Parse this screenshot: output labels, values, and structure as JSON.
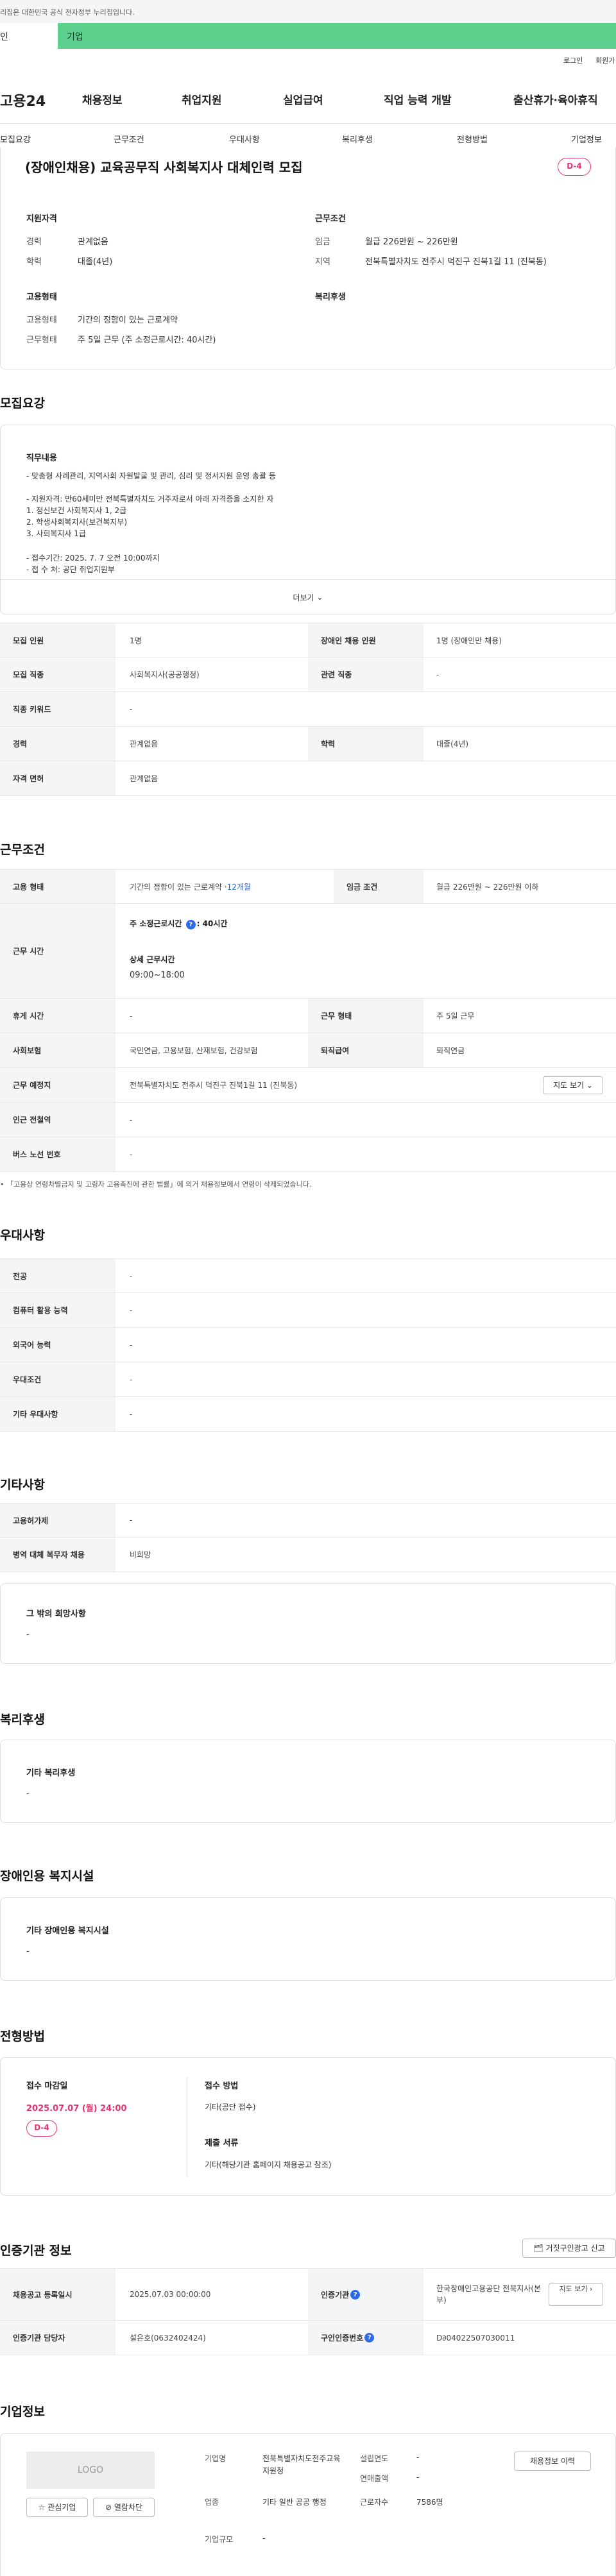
{
  "gov_notice": "리집은 대한민국 공식 전자정부 누리집입니다.",
  "top_tabs": [
    "인",
    "기업"
  ],
  "util": {
    "login": "로그인",
    "join": "회원가"
  },
  "gnb": {
    "logo": "고용24",
    "items": [
      "채용정보",
      "취업지원",
      "실업급여",
      "직업 능력 개발",
      "출산휴가·육아휴직"
    ]
  },
  "subnav": [
    "모집요강",
    "근무조건",
    "우대사항",
    "복리후생",
    "전형방법",
    "기업정보"
  ],
  "job": {
    "title": "(장애인채용) 교육공무직 사회복지사 대체인력 모집",
    "dday": "D-4"
  },
  "summary": {
    "qual_title": "지원자격",
    "career_label": "경력",
    "career": "관계없음",
    "edu_label": "학력",
    "edu": "대졸(4년)",
    "cond_title": "근무조건",
    "wage_label": "임금",
    "wage": "월급 226만원 ~ 226만원",
    "region_label": "지역",
    "region": "전북특별자치도 전주시 덕진구 진북1길 11 (진북동)",
    "emp_title": "고용형태",
    "emp_label": "고용형태",
    "emp": "기간의 정함이 있는 근로계약",
    "work_label": "근무형태",
    "work": "주 5일 근무 (주 소정근로시간: 40시간)",
    "welfare_title": "복리후생"
  },
  "recruit": {
    "section": "모집요강",
    "duty_title": "직무내용",
    "lines": [
      "- 맞춤형 사례관리, 지역사회 자원발굴 및 관리, 심리 및 정서지원 운영 총괄 등",
      "- 지원자격: 만60세미만 전북특별자치도 거주자로서 아래 자격증을 소지한 자",
      "1. 정신보건 사회복지사 1, 2급",
      "2. 학생사회복지사(보건복지부)",
      "3. 사회복지사 1급",
      "- 접수기간: 2025. 7. 7 오전 10:00까지",
      "- 접 수 처: 공단 취업지원부"
    ],
    "more": "더보기",
    "rows": [
      [
        "모집 인원",
        "1명",
        "장애인 채용 인원",
        "1명 (장애인만 채용)"
      ],
      [
        "모집 직종",
        "사회복지사(공공행정)",
        "관련 직종",
        "-"
      ],
      [
        "직종 키워드",
        "-"
      ],
      [
        "경력",
        "관계없음",
        "학력",
        "대졸(4년)"
      ],
      [
        "자격 면허",
        "관계없음"
      ]
    ]
  },
  "conditions": {
    "section": "근무조건",
    "emp_type_label": "고용 형태",
    "emp_type": "기간의 정함이 있는 근로계약 · ",
    "emp_months": "12개월",
    "wage_label": "임금 조건",
    "wage": "월급 226만원 ~ 226만원 이하",
    "time_label": "근무 시간",
    "weekly_label": "주 소정근로시간",
    "weekly": ": 40시간",
    "detail_label": "상세 근무시간",
    "detail": "09:00~18:00",
    "rest_label": "휴게 시간",
    "rest": "-",
    "form_label": "근무 형태",
    "form": "주 5일 근무",
    "ins_label": "사회보험",
    "ins": "국민연금, 고용보험, 산재보험, 건강보험",
    "sev_label": "퇴직급여",
    "sev": "퇴직연금",
    "place_label": "근무 예정지",
    "place": "전북특별자치도 전주시 덕진구 진북1길 11 (진북동)",
    "map_btn": "지도 보기",
    "station_label": "인근 전철역",
    "station": "-",
    "bus_label": "버스 노선 번호",
    "bus": "-",
    "note": "「고용상 연령차별금지 및 고령자 고용촉진에 관한 법률」에 의거 채용정보에서 연령이 삭제되었습니다."
  },
  "pref": {
    "section": "우대사항",
    "rows": [
      [
        "전공",
        "-"
      ],
      [
        "컴퓨터 활용 능력",
        "-"
      ],
      [
        "외국어 능력",
        "-"
      ],
      [
        "우대조건",
        "-"
      ],
      [
        "기타 우대사항",
        "-"
      ]
    ]
  },
  "etc": {
    "section": "기타사항",
    "rows": [
      [
        "고용허가제",
        "-"
      ],
      [
        "병역 대체 복무자 채용",
        "비희망"
      ]
    ],
    "hope_title": "그 밖의 희망사항",
    "hope": "-"
  },
  "welfare": {
    "section": "복리후생",
    "title": "기타 복리후생",
    "value": "-"
  },
  "facility": {
    "section": "장애인용 복지시설",
    "title": "기타 장애인용 복지시설",
    "value": "-"
  },
  "process": {
    "section": "전형방법",
    "deadline_label": "접수 마감일",
    "deadline": "2025.07.07 (월) 24:00",
    "dday": "D-4",
    "method_label": "접수 방법",
    "method": "기타(공단 접수)",
    "docs_label": "제출 서류",
    "docs": "기타(해당기관 홈페이지 채용공고 참조)"
  },
  "cert": {
    "section": "인증기관 정보",
    "report_btn": "거짓구인광고 신고",
    "reg_label": "채용공고 등록일시",
    "reg": "2025.07.03 00:00:00",
    "org_label": "인증기관",
    "org": "한국장애인고용공단 전북지사(본부)",
    "map_btn": "지도 보기",
    "mgr_label": "인증기관 담당자",
    "mgr": "설은호(0632402424)",
    "num_label": "구인인증번호",
    "num": "D∂04022507030011"
  },
  "company": {
    "section": "기업정보",
    "logo": "LOGO",
    "fav_btn": "관심기업",
    "block_btn": "열람차단",
    "name_label": "기업명",
    "name": "전북특별자치도전주교육지원청",
    "year_label": "설립연도",
    "year": "-",
    "sales_label": "연매출액",
    "sales": "-",
    "industry_label": "업종",
    "industry": "기타 일반 공공 행정",
    "emp_label": "근로자수",
    "emp": "7586명",
    "size_label": "기업규모",
    "size": "-",
    "more_btn": "채용정보 이력"
  }
}
